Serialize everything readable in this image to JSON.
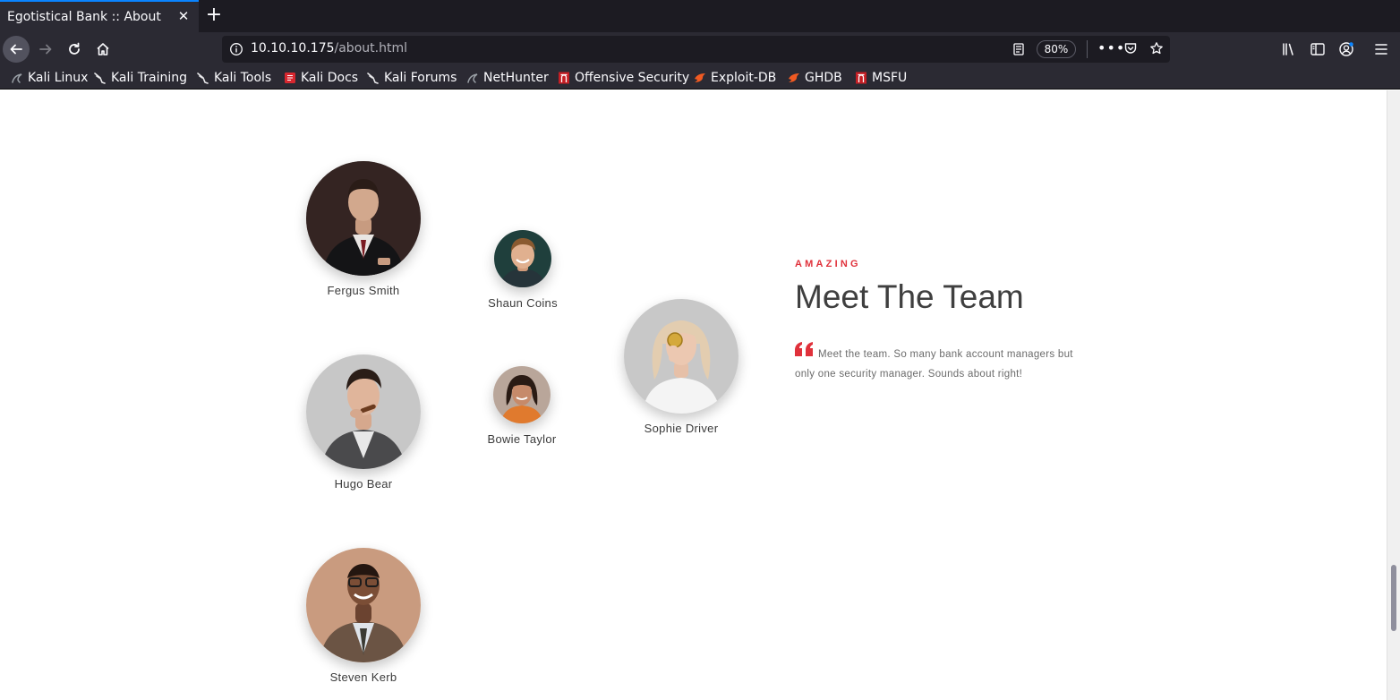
{
  "browser": {
    "tab_title": "Egotistical Bank :: About",
    "url_host": "10.10.10.175",
    "url_path": "/about.html",
    "zoom": "80%",
    "bookmarks": [
      {
        "label": "Kali Linux",
        "icon": "kali-dragon-icon"
      },
      {
        "label": "Kali Training",
        "icon": "kali-dragon-icon"
      },
      {
        "label": "Kali Tools",
        "icon": "kali-dragon-icon"
      },
      {
        "label": "Kali Docs",
        "icon": "kali-docs-icon"
      },
      {
        "label": "Kali Forums",
        "icon": "kali-dragon-icon"
      },
      {
        "label": "NetHunter",
        "icon": "kali-dragon-icon"
      },
      {
        "label": "Offensive Security",
        "icon": "offsec-icon"
      },
      {
        "label": "Exploit-DB",
        "icon": "exploit-db-icon"
      },
      {
        "label": "GHDB",
        "icon": "exploit-db-icon"
      },
      {
        "label": "MSFU",
        "icon": "offsec-icon"
      }
    ]
  },
  "team": {
    "kicker": "AMAZING",
    "heading": "Meet The Team",
    "blurb": "Meet the team. So many bank account managers but only one security manager. Sounds about right!",
    "members": [
      {
        "name": "Fergus Smith"
      },
      {
        "name": "Shaun Coins"
      },
      {
        "name": "Hugo Bear"
      },
      {
        "name": "Bowie Taylor"
      },
      {
        "name": "Sophie Driver"
      },
      {
        "name": "Steven Kerb"
      }
    ]
  },
  "colors": {
    "accent": "#e0313b",
    "chrome_dark": "#1c1b22",
    "chrome": "#2b2a33"
  }
}
